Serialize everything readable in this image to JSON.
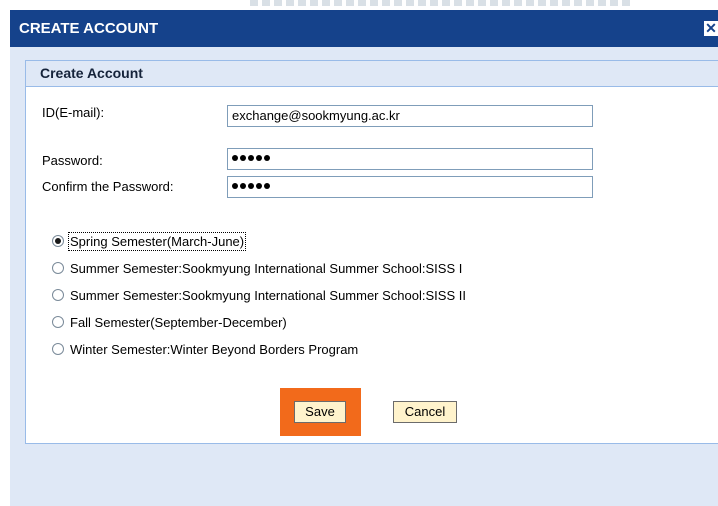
{
  "window": {
    "title": "CREATE ACCOUNT",
    "close_symbol": "✕"
  },
  "panel": {
    "title": "Create Account"
  },
  "form": {
    "id_label": "ID(E-mail):",
    "id_value": "exchange@sookmyung.ac.kr",
    "password_label": "Password:",
    "confirm_label": "Confirm the Password:",
    "password_length": 5,
    "confirm_length": 5
  },
  "semesters": [
    {
      "label": "Spring Semester(March-June)",
      "checked": true
    },
    {
      "label": "Summer Semester:Sookmyung International Summer School:SISS I",
      "checked": false
    },
    {
      "label": "Summer Semester:Sookmyung International Summer School:SISS II",
      "checked": false
    },
    {
      "label": "Fall Semester(September-December)",
      "checked": false
    },
    {
      "label": "Winter Semester:Winter Beyond Borders Program",
      "checked": false
    }
  ],
  "buttons": {
    "save": "Save",
    "cancel": "Cancel"
  },
  "colors": {
    "titlebar": "#15428b",
    "panel_bg": "#dfe8f6",
    "highlight": "#f26a1b",
    "button_bg": "#fff3cc"
  }
}
